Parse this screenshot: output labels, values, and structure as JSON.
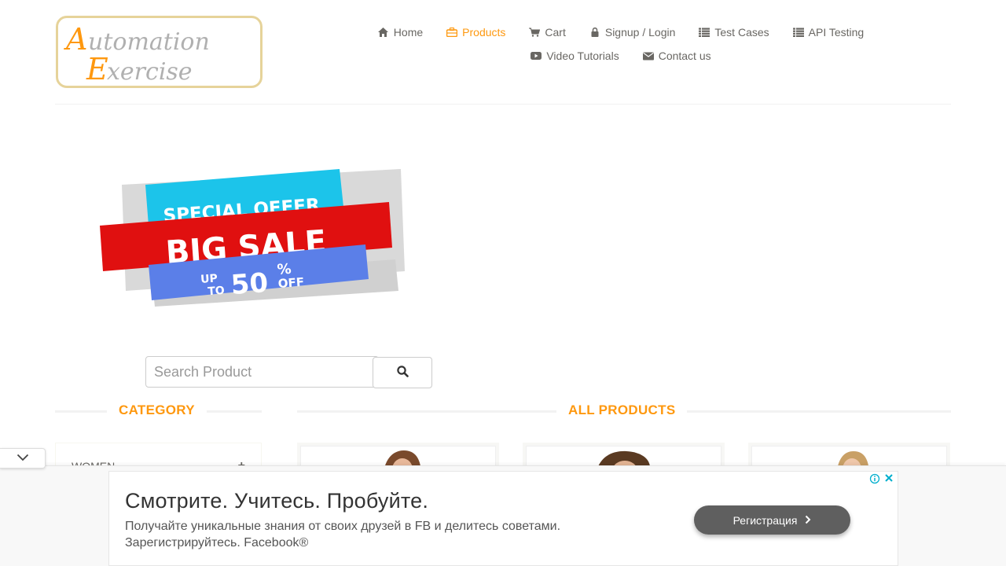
{
  "header": {
    "logo_text": "Automation Exercise",
    "nav": [
      {
        "label": "Home",
        "icon": "home-icon"
      },
      {
        "label": "Products",
        "icon": "briefcase-icon",
        "active": true
      },
      {
        "label": "Cart",
        "icon": "cart-icon"
      },
      {
        "label": "Signup / Login",
        "icon": "lock-icon"
      },
      {
        "label": "Test Cases",
        "icon": "list-icon"
      },
      {
        "label": "API Testing",
        "icon": "list-icon"
      },
      {
        "label": "Video Tutorials",
        "icon": "youtube-icon"
      },
      {
        "label": "Contact us",
        "icon": "envelope-icon"
      }
    ]
  },
  "banner": {
    "line1": "SPECIAL OFFER",
    "line2": "BIG SALE",
    "line3_up": "UP",
    "line3_to": "TO",
    "line3_pct": "50",
    "line3_sym": "%",
    "line3_off": "OFF"
  },
  "search": {
    "placeholder": "Search Product"
  },
  "sidebar": {
    "title": "CATEGORY",
    "items": [
      {
        "label": "Women"
      }
    ]
  },
  "main": {
    "title": "ALL PRODUCTS"
  },
  "ad": {
    "title": "Смотрите. Учитесь. Пробуйте.",
    "text": "Получайте уникальные знания от своих друзей в FB и делитесь советами. Зарегистрируйтесь. Facebook®",
    "button_label": "Регистрация"
  },
  "colors": {
    "accent": "#FE980F",
    "text": "#696763",
    "ad_button": "#5f5f5f"
  }
}
